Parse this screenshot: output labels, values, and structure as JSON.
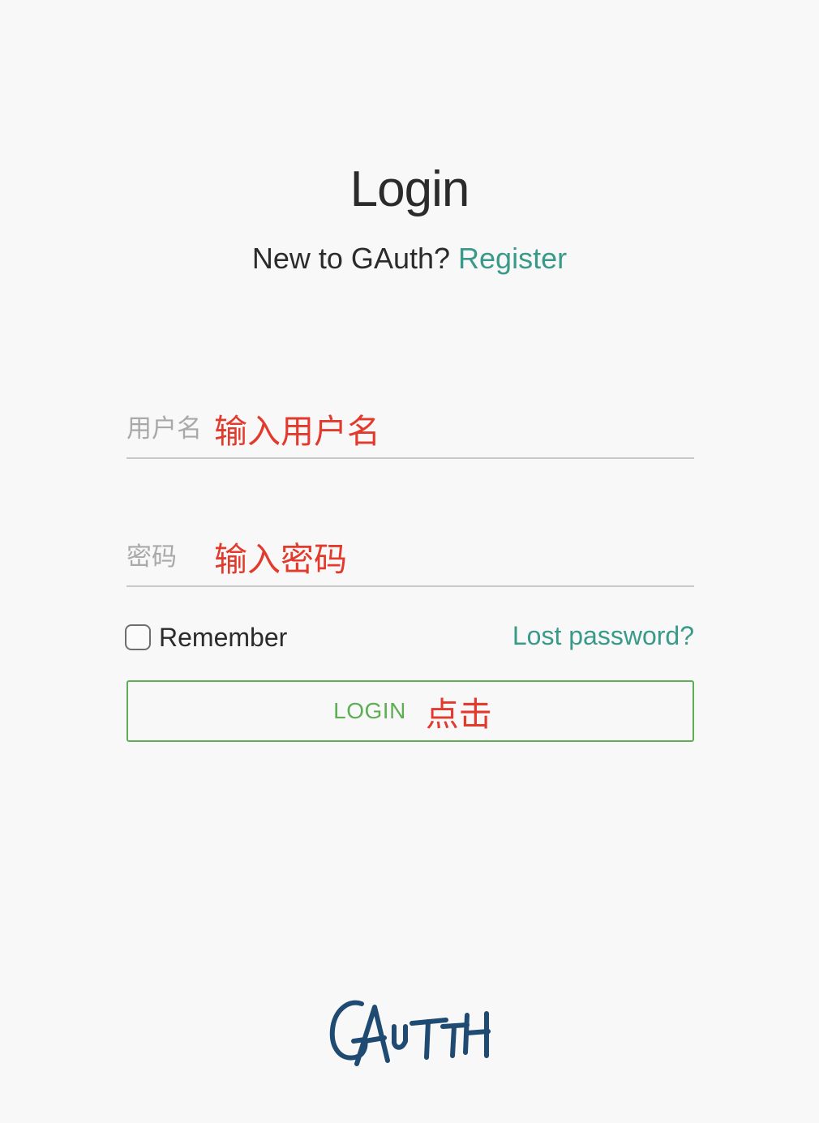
{
  "header": {
    "title": "Login",
    "subtitle_prefix": "New to GAuth?",
    "register_label": "Register"
  },
  "form": {
    "username": {
      "placeholder": "用户名",
      "annotation": "输入用户名"
    },
    "password": {
      "placeholder": "密码",
      "annotation": "输入密码"
    },
    "remember_label": "Remember",
    "remember_checked": false,
    "lost_password_label": "Lost password?",
    "login_label": "LOGIN",
    "login_annotation": "点击"
  },
  "brand": {
    "logo_text": "GAuth",
    "logo_color": "#1f4a72"
  },
  "colors": {
    "accent_link": "#3a9a8a",
    "login_button": "#5fae56",
    "annotation": "#e23a2c"
  }
}
